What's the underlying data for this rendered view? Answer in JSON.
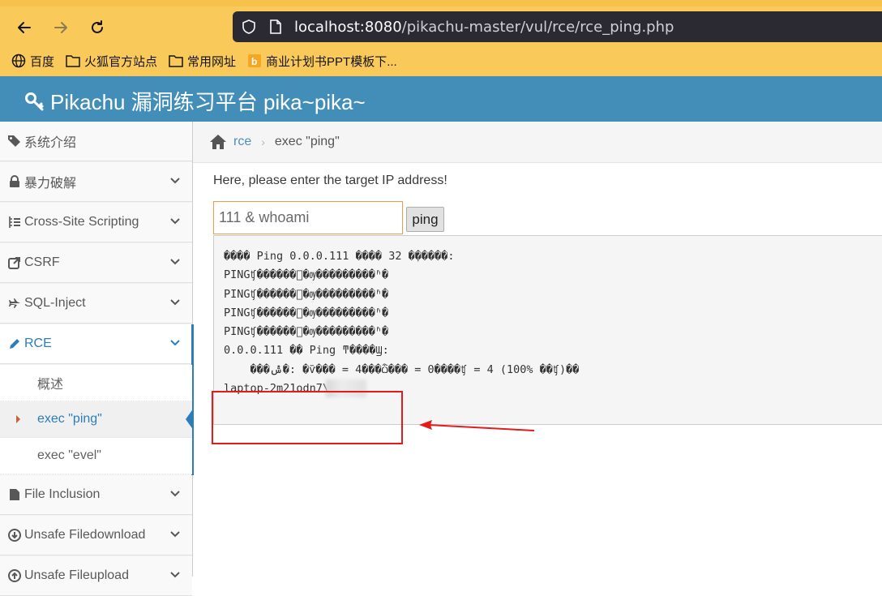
{
  "browser": {
    "url_host": "localhost:8080",
    "url_path": "/pikachu-master/vul/rce/rce_ping.php",
    "bookmarks": [
      "百度",
      "火狐官方站点",
      "常用网址",
      "商业计划书PPT模板下..."
    ]
  },
  "app": {
    "title": "Pikachu 漏洞练习平台 pika~pika~"
  },
  "sidebar": {
    "items": [
      {
        "label": "系统介绍",
        "icon": "tags-icon"
      },
      {
        "label": "暴力破解",
        "icon": "lock-icon"
      },
      {
        "label": "Cross-Site Scripting",
        "icon": "list-icon"
      },
      {
        "label": "CSRF",
        "icon": "share-icon"
      },
      {
        "label": "SQL-Inject",
        "icon": "plane-icon"
      },
      {
        "label": "RCE",
        "icon": "pencil-icon"
      },
      {
        "label": "File Inclusion",
        "icon": "file-icon"
      },
      {
        "label": "Unsafe Filedownload",
        "icon": "download-icon"
      },
      {
        "label": "Unsafe Fileupload",
        "icon": "upload-icon"
      }
    ],
    "rce_sub": [
      "概述",
      "exec \"ping\"",
      "exec \"evel\""
    ]
  },
  "breadcrumb": {
    "link": "rce",
    "current": "exec \"ping\""
  },
  "main": {
    "prompt": "Here, please enter the target IP address!",
    "input_value": "111 & whoami",
    "button_label": "ping",
    "output_lines": [
      "���� Ping 0.0.0.111 ���� 32 �ֽ�����:",
      "PINGʧ������ͨ�ѹ���������ʱ�",
      "PINGʧ������ͨ�ѹ���������ʱ�",
      "PINGʧ������ͨ�ѹ���������ʱ�",
      "PINGʧ������ͨ�ѹ���������ʱ�",
      "",
      "0.0.0.111 �� Ping ͳ����Ϣ:",
      "    ���ݰ�: �ѷ��� = 4���ѽ��� = 0����ʧ = 4 (100% ��ʧ)��",
      "laptop-2m21odn7\\"
    ]
  },
  "colors": {
    "header": "#438eb9",
    "accent": "#2b7dbc",
    "annotation": "#e41b1b"
  }
}
